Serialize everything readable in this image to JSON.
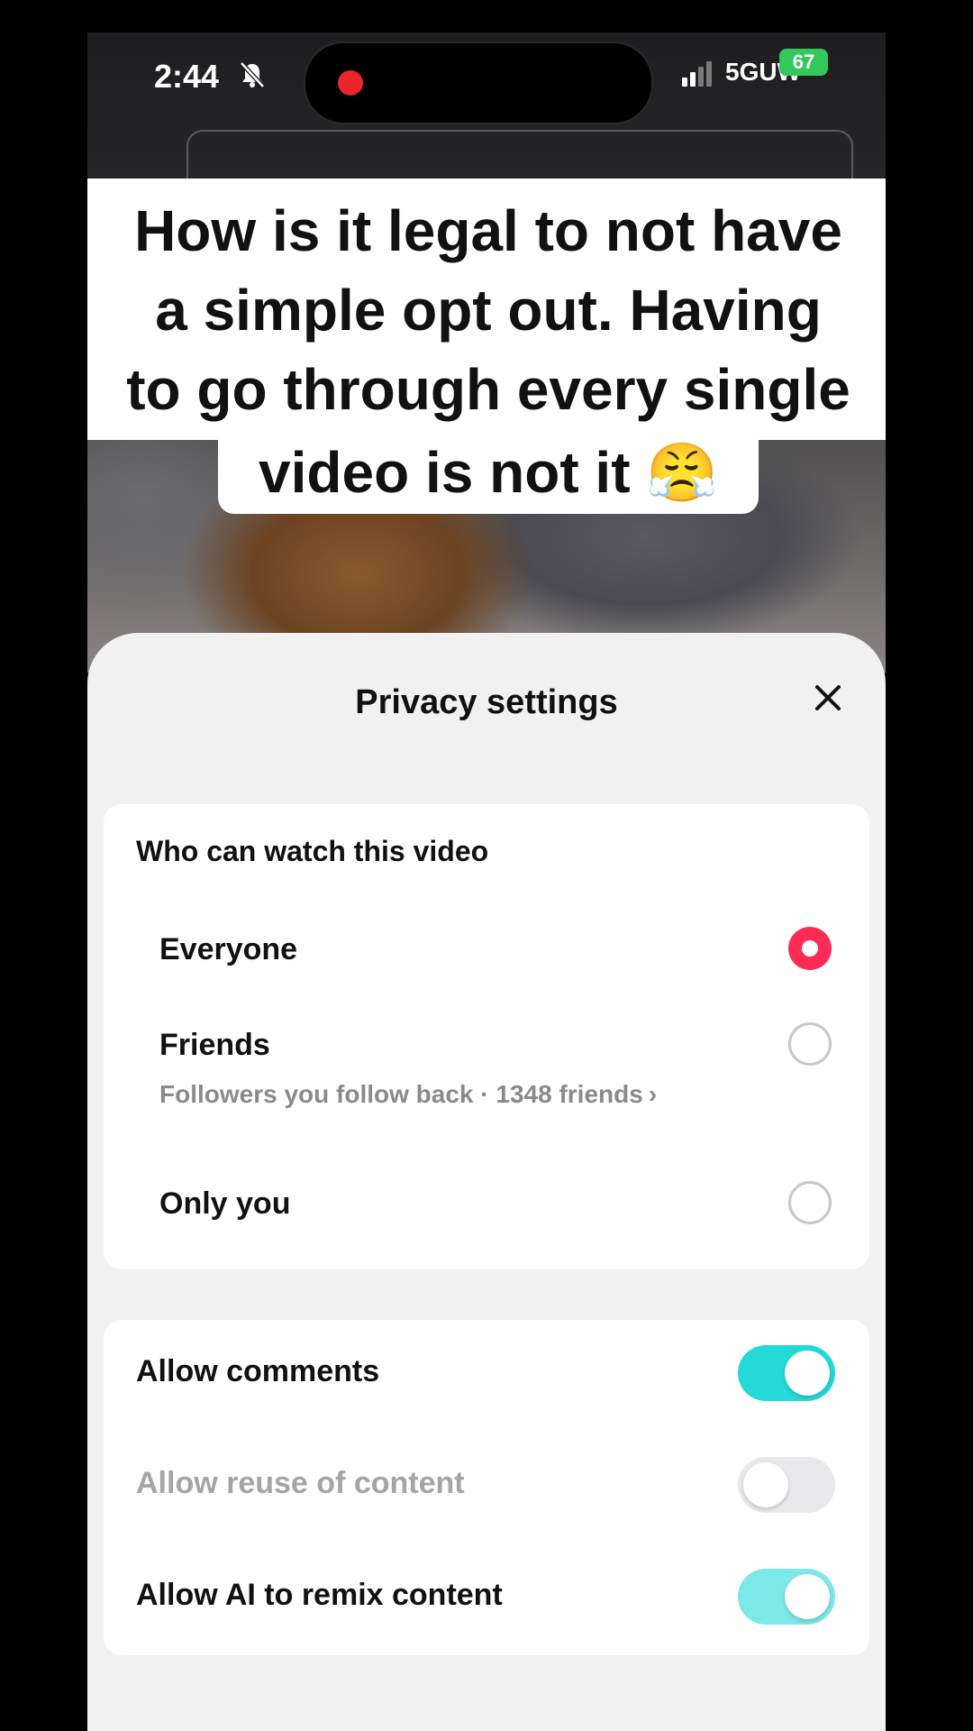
{
  "status_bar": {
    "time": "2:44",
    "network": "5GUW",
    "battery": "67"
  },
  "caption": {
    "lines": [
      "How is it legal to not have",
      "a simple opt out. Having",
      "to go through every single"
    ],
    "last_line": "video is not it 😤"
  },
  "sheet": {
    "title": "Privacy settings",
    "watch": {
      "title": "Who can watch this video",
      "options": [
        {
          "label": "Everyone",
          "selected": true
        },
        {
          "label": "Friends",
          "sub": "Followers you follow back · 1348 friends",
          "selected": false
        },
        {
          "label": "Only you",
          "selected": false
        }
      ]
    },
    "permissions": [
      {
        "label": "Allow comments",
        "state": "on",
        "enabled": true
      },
      {
        "label": "Allow reuse of content",
        "state": "off",
        "enabled": false
      },
      {
        "label": "Allow AI to remix content",
        "state": "on",
        "enabled": true
      }
    ]
  },
  "colors": {
    "accent_red": "#fe2c55",
    "toggle_on": "#25d9d9",
    "toggle_on_faded": "#7de8e8",
    "toggle_off": "#e9e9eb"
  }
}
